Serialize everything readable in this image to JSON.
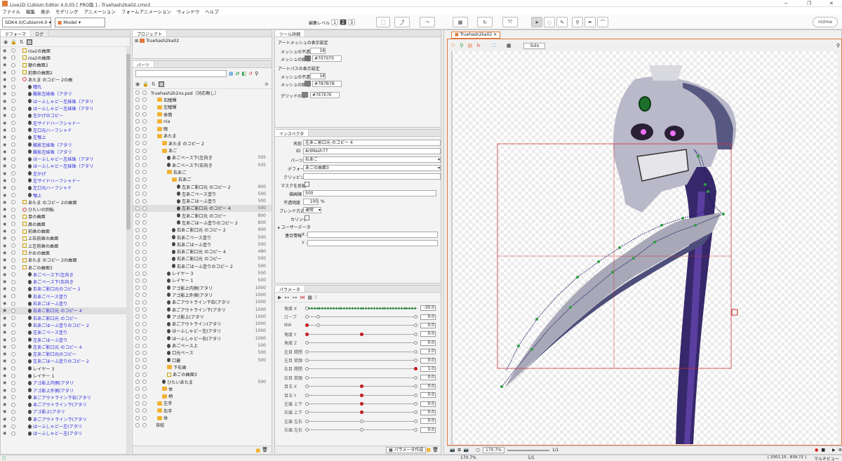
{
  "app": {
    "title": "Live2D Cubism Editor 4.0.05   [ PRO版 ] - Truehash2ka02.cmo3"
  },
  "menu": [
    "ファイル",
    "編集",
    "表示",
    "モデリング",
    "アニメーション",
    "フォームアニメーション",
    "ウィンドウ",
    "ヘルプ"
  ],
  "toolbar": {
    "sdk": "SDK4.0/Cubism4.0",
    "mode": "Model",
    "edit_level_label": "編集レベル :",
    "levels": [
      "1",
      "2",
      "3"
    ],
    "brand": "nizima"
  },
  "left_panel": {
    "tabs": [
      "デフォーマ",
      "ログ"
    ],
    "rows": [
      {
        "t": "nia2の曲面",
        "i": "warp",
        "d": 1,
        "c": false
      },
      {
        "t": "nia2の曲面",
        "i": "warp",
        "d": 1,
        "c": false
      },
      {
        "t": "額の曲面2",
        "i": "warp",
        "d": 1,
        "c": false
      },
      {
        "t": "前面の曲面2",
        "i": "warp",
        "d": 1,
        "c": false
      },
      {
        "t": "あたま のコピー 2の曲",
        "i": "rot",
        "d": 1,
        "c": false
      },
      {
        "t": "瞳孔",
        "i": "art",
        "d": 2,
        "c": true
      },
      {
        "t": "酸影左妹珠（アタリ",
        "i": "art",
        "d": 2,
        "c": true
      },
      {
        "t": "はーふしゃどー左妹珠（アタリ",
        "i": "art",
        "d": 2,
        "c": true
      },
      {
        "t": "はーふしゃどー左妹珠（アタリ",
        "i": "art",
        "d": 2,
        "c": true
      },
      {
        "t": "左かげのコピー",
        "i": "art",
        "d": 2,
        "c": true
      },
      {
        "t": "左サイドハーフシャドー",
        "i": "art",
        "d": 2,
        "c": true
      },
      {
        "t": "左口元ハーフシャド",
        "i": "art",
        "d": 2,
        "c": true
      },
      {
        "t": "左顎上",
        "i": "art",
        "d": 2,
        "c": true
      },
      {
        "t": "酸影左妹珠（アタリ",
        "i": "art",
        "d": 2,
        "c": true
      },
      {
        "t": "酸影左妹珠（アタリ",
        "i": "art",
        "d": 2,
        "c": true
      },
      {
        "t": "はーふしゃどー左妹珠（アタリ",
        "i": "art",
        "d": 2,
        "c": true
      },
      {
        "t": "はーふしゃどー左妹珠（アタリ",
        "i": "art",
        "d": 2,
        "c": true
      },
      {
        "t": "左かげ",
        "i": "art",
        "d": 2,
        "c": true
      },
      {
        "t": "左サイドハーフシャドー",
        "i": "art",
        "d": 2,
        "c": true
      },
      {
        "t": "左口元ハーフシャド",
        "i": "art",
        "d": 2,
        "c": true
      },
      {
        "t": "顎上",
        "i": "art",
        "d": 2,
        "c": true
      },
      {
        "t": "あたま のコピー 2の曲面",
        "i": "warp",
        "d": 1,
        "c": false
      },
      {
        "t": "ひたいの回転",
        "i": "rot",
        "d": 1,
        "c": false
      },
      {
        "t": "目の曲面",
        "i": "warp",
        "d": 1,
        "c": false
      },
      {
        "t": "鼻の曲面",
        "i": "warp",
        "d": 1,
        "c": false
      },
      {
        "t": "前歯の曲面",
        "i": "warp",
        "d": 1,
        "c": false
      },
      {
        "t": "上右前歯の曲面",
        "i": "warp",
        "d": 1,
        "c": false
      },
      {
        "t": "上左前歯の曲面",
        "i": "warp",
        "d": 1,
        "c": false
      },
      {
        "t": "かおの曲面",
        "i": "warp",
        "d": 1,
        "c": false
      },
      {
        "t": "あたま のコピー 2の曲面",
        "i": "warp",
        "d": 1,
        "c": false
      },
      {
        "t": "あごの曲面3",
        "i": "warp",
        "d": 1,
        "c": false
      },
      {
        "t": "あごベース下(左向き",
        "i": "art",
        "d": 2,
        "c": true
      },
      {
        "t": "あごベース下(右向き",
        "i": "art",
        "d": 2,
        "c": true
      },
      {
        "t": "右あご影口元のコピー 2",
        "i": "art",
        "d": 2,
        "c": true
      },
      {
        "t": "右あごベース塗り",
        "i": "art",
        "d": 2,
        "c": true
      },
      {
        "t": "右あごぼーふ塗り",
        "i": "art",
        "d": 2,
        "c": true
      },
      {
        "t": "右あご影口元 のコピー 4",
        "i": "art",
        "d": 2,
        "c": true
      },
      {
        "t": "右あご影口元 のコピー",
        "i": "art",
        "d": 2,
        "c": true
      },
      {
        "t": "右あごはーふ塗りのコピー 2",
        "i": "art",
        "d": 2,
        "c": true
      },
      {
        "t": "左あごベース塗り",
        "i": "art",
        "d": 2,
        "c": true
      },
      {
        "t": "左あごはーふ塗り",
        "i": "art",
        "d": 2,
        "c": true
      },
      {
        "t": "左あご影口元 のコピー 4",
        "i": "art",
        "d": 2,
        "c": true
      },
      {
        "t": "左あご影口元のコピー",
        "i": "art",
        "d": 2,
        "c": true
      },
      {
        "t": "左あごはーふ塗りのコピー 2",
        "i": "art",
        "d": 2,
        "c": true
      },
      {
        "t": "レイヤー 3",
        "i": "art",
        "d": 2,
        "c": false
      },
      {
        "t": "レイヤー 1",
        "i": "art",
        "d": 2,
        "c": false
      },
      {
        "t": "アゴ影上内側(アタリ",
        "i": "art",
        "d": 2,
        "c": true
      },
      {
        "t": "アゴ影上外側(アタリ",
        "i": "art",
        "d": 2,
        "c": true
      },
      {
        "t": "あごアウトライン下右(アタリ",
        "i": "art",
        "d": 2,
        "c": true
      },
      {
        "t": "あごアウトライン下(アタリ",
        "i": "art",
        "d": 2,
        "c": true
      },
      {
        "t": "アゴ影上(アタリ",
        "i": "art",
        "d": 2,
        "c": true
      },
      {
        "t": "あごアウトライン下(アタリ",
        "i": "art",
        "d": 2,
        "c": true
      },
      {
        "t": "はーふしゃどー左(アタリ",
        "i": "art",
        "d": 2,
        "c": true
      },
      {
        "t": "はーふしゃどー左(アタリ",
        "i": "art",
        "d": 2,
        "c": true
      }
    ]
  },
  "project": {
    "tab": "プロジェクト",
    "file": "Truehash2ka02"
  },
  "parts": {
    "tab": "パーツ",
    "rows": [
      {
        "t": "Truehash2k2ns.psd（対応無し）",
        "d": 0,
        "i": "none",
        "n": ""
      },
      {
        "t": "右瞳輝",
        "d": 1,
        "i": "fold",
        "n": ""
      },
      {
        "t": "左瞳輝",
        "d": 1,
        "i": "fold",
        "n": ""
      },
      {
        "t": "表情",
        "d": 1,
        "i": "fold",
        "n": ""
      },
      {
        "t": "nia",
        "d": 1,
        "i": "fold",
        "n": ""
      },
      {
        "t": "眼",
        "d": 1,
        "i": "fold",
        "n": ""
      },
      {
        "t": "あたま",
        "d": 1,
        "i": "fold",
        "n": ""
      },
      {
        "t": "あたま のコピー 2",
        "d": 2,
        "i": "fold",
        "n": ""
      },
      {
        "t": "あご",
        "d": 2,
        "i": "fold",
        "n": ""
      },
      {
        "t": "あごベース下(左向き",
        "d": 3,
        "i": "art",
        "n": "505"
      },
      {
        "t": "あごベース下(右向き",
        "d": 3,
        "i": "art",
        "n": "505"
      },
      {
        "t": "右あご",
        "d": 3,
        "i": "fold",
        "n": ""
      },
      {
        "t": "右あご",
        "d": 4,
        "i": "fold",
        "n": ""
      },
      {
        "t": "左あご影口元 のコピー 2",
        "d": 5,
        "i": "art",
        "n": "900"
      },
      {
        "t": "左あごベース塗り",
        "d": 5,
        "i": "art",
        "n": "500"
      },
      {
        "t": "左あごはーふ塗り",
        "d": 5,
        "i": "art",
        "n": "500"
      },
      {
        "t": "左あご影口元 のコピー 4",
        "d": 5,
        "i": "art",
        "n": "500",
        "hi": true
      },
      {
        "t": "左あご影口元 のコピー",
        "d": 5,
        "i": "art",
        "n": "800"
      },
      {
        "t": "左あごはーふ塗りのコピー 2",
        "d": 5,
        "i": "art",
        "n": "800"
      },
      {
        "t": "右あご影口元 のコピー 2",
        "d": 4,
        "i": "art",
        "n": "900"
      },
      {
        "t": "右あごベース塗り",
        "d": 4,
        "i": "art",
        "n": "500"
      },
      {
        "t": "右あごはーふ塗り",
        "d": 4,
        "i": "art",
        "n": "500"
      },
      {
        "t": "右あご影口元 のコピー 4",
        "d": 4,
        "i": "art",
        "n": "480"
      },
      {
        "t": "右あご影口元 のコピー",
        "d": 4,
        "i": "art",
        "n": "500"
      },
      {
        "t": "右あごはーふ塗りのコピー 2",
        "d": 4,
        "i": "art",
        "n": "500"
      },
      {
        "t": "レイヤー 3",
        "d": 3,
        "i": "art",
        "n": "500"
      },
      {
        "t": "レイヤー 1",
        "d": 3,
        "i": "art",
        "n": "500"
      },
      {
        "t": "アゴ影上内側(アタリ",
        "d": 3,
        "i": "art",
        "n": "1000"
      },
      {
        "t": "アゴ影上外側(アタリ",
        "d": 3,
        "i": "art",
        "n": "1000"
      },
      {
        "t": "あごアウトライン下右(アタリ",
        "d": 3,
        "i": "art",
        "n": "1000"
      },
      {
        "t": "あごアウトライン下(アタリ",
        "d": 3,
        "i": "art",
        "n": "1000"
      },
      {
        "t": "アゴ影上(アタリ",
        "d": 3,
        "i": "art",
        "n": "1000"
      },
      {
        "t": "あごアウトライン(アタリ",
        "d": 3,
        "i": "art",
        "n": "1000"
      },
      {
        "t": "はーふしゃどー左(アタリ",
        "d": 3,
        "i": "art",
        "n": "1000"
      },
      {
        "t": "はーふしゃどー右(アタリ",
        "d": 3,
        "i": "art",
        "n": "1000"
      },
      {
        "t": "あごベース上",
        "d": 3,
        "i": "art",
        "n": "500"
      },
      {
        "t": "口元ベース",
        "d": 3,
        "i": "art",
        "n": "500"
      },
      {
        "t": "口蓋",
        "d": 3,
        "i": "art",
        "n": "500"
      },
      {
        "t": "下右歯",
        "d": 3,
        "i": "fold",
        "n": ""
      },
      {
        "t": "あごの曲面3",
        "d": 3,
        "i": "warp",
        "n": ""
      },
      {
        "t": "ひたいあたま",
        "d": 2,
        "i": "art",
        "n": "500"
      },
      {
        "t": "体",
        "d": 2,
        "i": "fold",
        "n": ""
      },
      {
        "t": "柄",
        "d": 2,
        "i": "fold",
        "n": ""
      },
      {
        "t": "左手",
        "d": 1,
        "i": "fold",
        "n": ""
      },
      {
        "t": "右手",
        "d": 1,
        "i": "fold",
        "n": ""
      },
      {
        "t": "体",
        "d": 1,
        "i": "fold",
        "n": ""
      },
      {
        "t": "背絵",
        "d": 1,
        "i": "none",
        "n": ""
      }
    ]
  },
  "tool_detail": {
    "tab": "ツール詳細",
    "art_mesh_section": "アートメッシュの表示設定",
    "mesh_opacity_label": "メッシュの不透明度",
    "mesh_opacity": "18",
    "mesh_color_label": "メッシュの線色",
    "mesh_color": "#707070",
    "art_path_section": "アートパスの表示設定",
    "path_opacity_label": "メッシュの不透明度",
    "path_opacity": "18",
    "path_color_label": "メッシュの線色",
    "path_color": "#7B7B7B",
    "grid_color_label": "グリッドの色",
    "grid_color": "#7E7E7E"
  },
  "inspector": {
    "tab": "インスペクタ",
    "name_label": "名前",
    "name": "左あご影口元 のコピー 4",
    "id_label": "ID",
    "id": "ArtMesh77",
    "parts_label": "パーツ",
    "parts": "右あご",
    "deformer_label": "デフォーマ",
    "deformer": "あごの曲面3",
    "clipping_label": "クリッピング",
    "mask_label": "マスクを反転",
    "draw_order_label": "描画順",
    "draw_order": "500",
    "opacity_label": "不透明度",
    "opacity": "100",
    "opacity_unit": "%",
    "blend_label": "ブレンド方式",
    "blend": "通常",
    "culling_label": "カリング",
    "user_data_label": "ユーザーデータ",
    "link_label": "連合情報",
    "x_label": "X :",
    "y_label": "Y :"
  },
  "params": {
    "tab": "パラメータ",
    "create_label": "パラメータ作成",
    "rows": [
      {
        "n": "角度 X",
        "v": "-30.0",
        "k": [
          0
        ],
        "dotted": true
      },
      {
        "n": "ロープ",
        "v": "0.0",
        "k": [
          0,
          0.1,
          1
        ]
      },
      {
        "n": "NIA",
        "v": "0.0",
        "k": [
          0,
          0.1,
          1
        ],
        "red": [
          0
        ]
      },
      {
        "n": "角度 Y",
        "v": "0.0",
        "k": [
          0,
          0.5,
          1
        ],
        "red": [
          0,
          0.5
        ]
      },
      {
        "n": "角度 Z",
        "v": "0.0",
        "k": [
          0,
          1
        ]
      },
      {
        "n": "左目 開閉",
        "v": "1.0",
        "k": [
          0,
          1
        ]
      },
      {
        "n": "左目 笑顔",
        "v": "0.0",
        "k": [
          0,
          1
        ]
      },
      {
        "n": "右目 開閉",
        "v": "1.0",
        "k": [
          0,
          1
        ],
        "red": [
          1
        ]
      },
      {
        "n": "右目 笑顔",
        "v": "0.0",
        "k": [
          0,
          1
        ]
      },
      {
        "n": "目玉 X",
        "v": "0.0",
        "k": [
          0,
          0.5,
          1
        ],
        "red": [
          0.5
        ]
      },
      {
        "n": "目玉 Y",
        "v": "0.0",
        "k": [
          0,
          0.5,
          1
        ],
        "red": [
          0.5
        ]
      },
      {
        "n": "左眉 上下",
        "v": "0.0",
        "k": [
          0,
          0.5,
          1
        ],
        "red": [
          0.5
        ]
      },
      {
        "n": "右眉 上下",
        "v": "0.0",
        "k": [
          0,
          0.5,
          1
        ],
        "red": [
          0.5
        ]
      },
      {
        "n": "左眉 左右",
        "v": "0.0",
        "k": [
          0,
          0.5,
          1
        ]
      },
      {
        "n": "右眉 左右",
        "v": "0.0",
        "k": [
          0,
          0.5,
          1
        ]
      }
    ]
  },
  "viewport": {
    "tab": "Truehash2ka02",
    "solo": "Solo",
    "zoom": "170.7%",
    "page": "1/1",
    "right_status": "マルチビュー",
    "coords": "[ 2001.15 , 839.72 ]",
    "size": "1168×1104"
  },
  "colors": {
    "accent": "#e0793a",
    "selection": "#cc3333",
    "mesh": "#2ea043"
  }
}
